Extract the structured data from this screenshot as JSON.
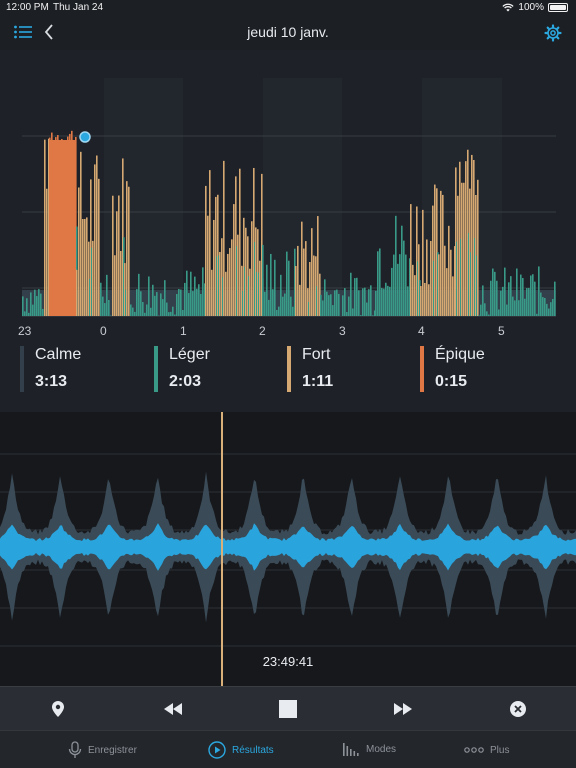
{
  "status_bar": {
    "time": "12:00 PM",
    "date": "Thu Jan 24",
    "battery": "100%"
  },
  "nav": {
    "title": "jeudi 10 janv."
  },
  "chart_data": {
    "type": "bar",
    "x_tick_labels": [
      "23",
      "0",
      "1",
      "2",
      "3",
      "4",
      "5"
    ],
    "categories": [
      "Calme",
      "Léger",
      "Fort",
      "Épique"
    ],
    "colors": {
      "Calme": "#33404c",
      "Léger": "#3a9a88",
      "Fort": "#d6a872",
      "Épique": "#e07846"
    },
    "category_durations": [
      "3:13",
      "2:03",
      "1:11",
      "0:15"
    ],
    "grid": true
  },
  "legend": [
    {
      "label": "Calme",
      "value": "3:13",
      "color": "#33404c"
    },
    {
      "label": "Léger",
      "value": "2:03",
      "color": "#3a9a88"
    },
    {
      "label": "Fort",
      "value": "1:11",
      "color": "#d6a872"
    },
    {
      "label": "Épique",
      "value": "0:15",
      "color": "#e07846"
    }
  ],
  "waveform": {
    "timestamp": "23:49:41",
    "color": "#2aa4dc",
    "envelope_color": "#3a4a56",
    "cursor_color": "#d9b07a"
  },
  "controls": [
    "location-pin-icon",
    "rewind-icon",
    "stop-icon",
    "fast-forward-icon",
    "close-circle-icon"
  ],
  "tabs": [
    {
      "label": "Enregistrer",
      "icon": "microphone-icon",
      "active": false
    },
    {
      "label": "Résultats",
      "icon": "play-circle-icon",
      "active": true
    },
    {
      "label": "Modes",
      "icon": "bar-chart-icon",
      "active": false
    },
    {
      "label": "Plus",
      "icon": "more-dots-icon",
      "active": false
    }
  ],
  "accent_color": "#2ba8e0"
}
